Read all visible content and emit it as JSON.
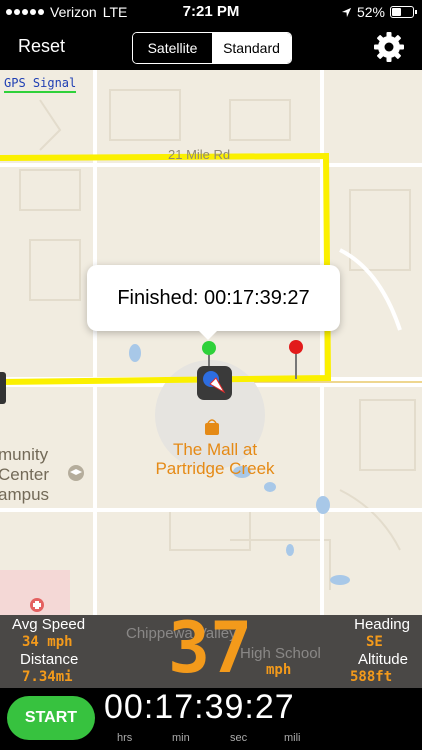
{
  "status_bar": {
    "carrier": "Verizon",
    "network": "LTE",
    "time": "7:21 PM",
    "battery": "52%",
    "battery_level": 0.52
  },
  "nav": {
    "reset_label": "Reset",
    "segments": {
      "satellite": "Satellite",
      "standard": "Standard"
    },
    "selected_segment": "Standard"
  },
  "map": {
    "gps_label": "GPS Signal",
    "road_label": "21 Mile Rd",
    "callout_text": "Finished: 00:17:39:27",
    "mall_name_line1": "The Mall at",
    "mall_name_line2": "Partridge Creek",
    "college_line1": "munity",
    "college_line2": "Center",
    "college_line3": "ampus",
    "school_line1": "Chippewa Valley",
    "school_line2": "High School"
  },
  "stats": {
    "avg_speed_label": "Avg Speed",
    "avg_speed_value": "34 mph",
    "distance_label": "Distance",
    "distance_value": "7.34mi",
    "speed": "37",
    "speed_unit": "mph",
    "heading_label": "Heading",
    "heading_value": "SE",
    "altitude_label": "Altitude",
    "altitude_value": "588ft"
  },
  "bottom": {
    "start_label": "START",
    "timer": {
      "hrs": "00",
      "min": "17",
      "sec": "39",
      "mili": "27"
    },
    "labels": {
      "hrs": "hrs",
      "min": "min",
      "sec": "sec",
      "mili": "mili"
    }
  },
  "colors": {
    "accent_orange": "#f39a1b",
    "route_yellow": "#fbf000",
    "start_green": "#37c23f"
  }
}
